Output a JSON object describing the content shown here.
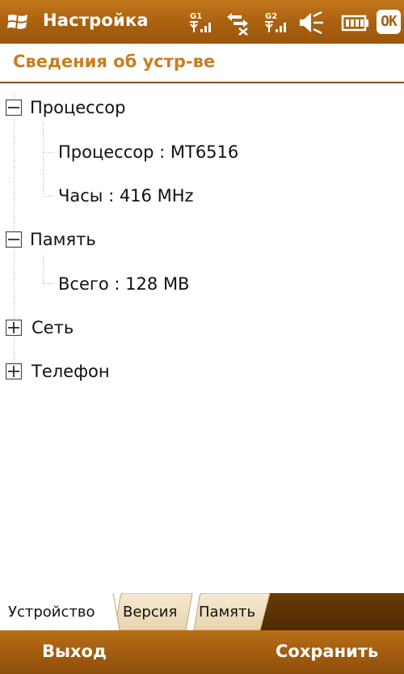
{
  "titlebar": {
    "title": "Настройка",
    "ok_label": "OK"
  },
  "header": {
    "title": "Сведения об устр-ве"
  },
  "tree": {
    "processor": {
      "label": "Процессор",
      "children": [
        "Процессор : MT6516",
        "Часы : 416 MHz"
      ]
    },
    "memory": {
      "label": "Память",
      "children": [
        "Всего : 128 MB"
      ]
    },
    "network": {
      "label": "Сеть"
    },
    "phone": {
      "label": "Телефон"
    }
  },
  "tabs": [
    {
      "label": "Устройство",
      "active": true
    },
    {
      "label": "Версия",
      "active": false
    },
    {
      "label": "Память",
      "active": false
    }
  ],
  "softkeys": {
    "left": "Выход",
    "right": "Сохранить"
  },
  "colors": {
    "accent": "#a9600f",
    "title_text": "#c97e22",
    "tab_inactive": "#f1e2c6",
    "tab_dark": "#5e3406"
  }
}
